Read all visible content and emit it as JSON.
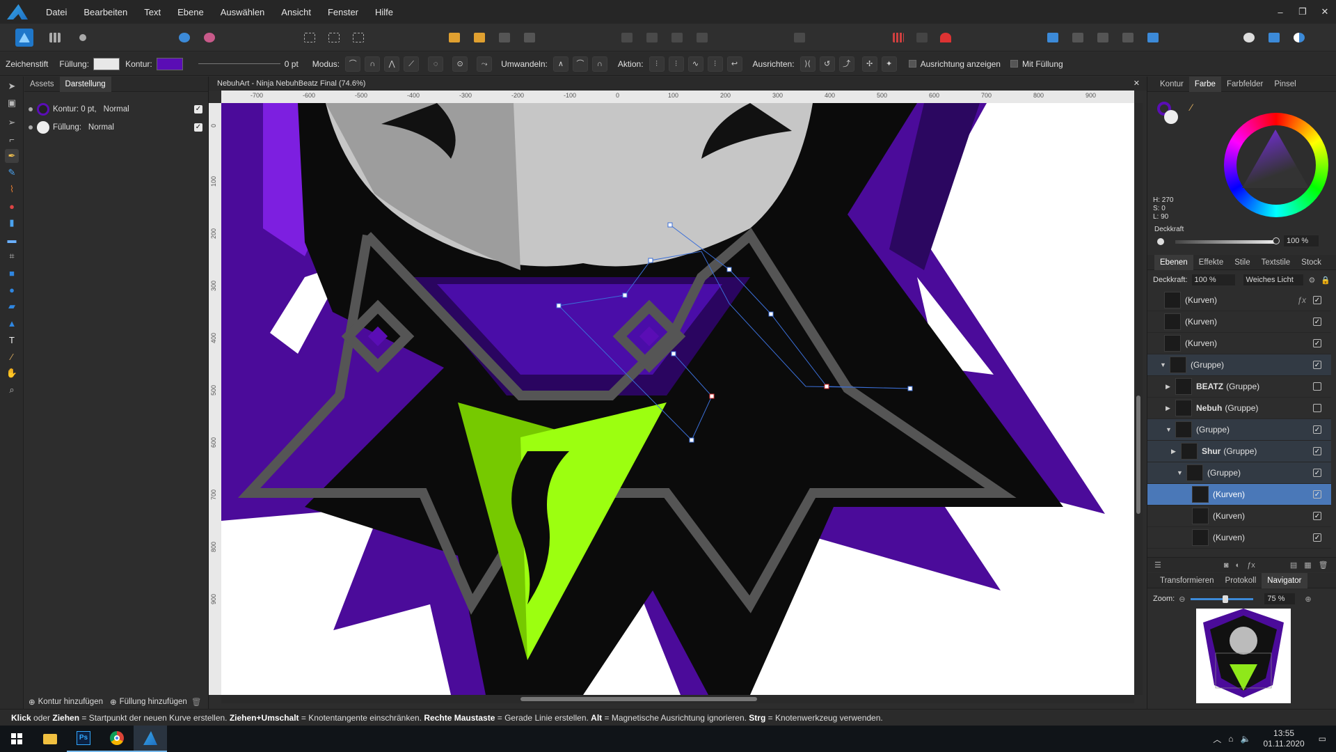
{
  "menubar": {
    "items": [
      "Datei",
      "Bearbeiten",
      "Text",
      "Ebene",
      "Auswählen",
      "Ansicht",
      "Fenster",
      "Hilfe"
    ],
    "window_controls": [
      "–",
      "❐",
      "✕"
    ]
  },
  "context": {
    "tool_name": "Zeichenstift",
    "fill_label": "Füllung:",
    "stroke_label": "Kontur:",
    "stroke_width": "0 pt",
    "mode_label": "Modus:",
    "convert_label": "Umwandeln:",
    "action_label": "Aktion:",
    "align_label": "Ausrichten:",
    "show_alignment": "Ausrichtung anzeigen",
    "with_fill": "Mit Füllung",
    "fill_color": "#e8e8e8",
    "stroke_color": "#5a0db5"
  },
  "leftpanel": {
    "tabs": [
      "Assets",
      "Darstellung"
    ],
    "active_tab": "Darstellung",
    "rows": [
      {
        "label": "Kontur: 0 pt,",
        "blend": "Normal"
      },
      {
        "label": "Füllung:",
        "blend": "Normal"
      }
    ],
    "add_stroke": "Kontur hinzufügen",
    "add_fill": "Füllung hinzufügen"
  },
  "document": {
    "title": "NebuhArt - Ninja NebuhBeatz Final (74.6%)",
    "close": "✕",
    "ruler_h": [
      "-700",
      "-600",
      "-500",
      "-400",
      "-300",
      "-200",
      "-100",
      "0",
      "100",
      "200",
      "300",
      "400",
      "500",
      "600",
      "700",
      "800",
      "900"
    ],
    "ruler_v": [
      "0",
      "100",
      "200",
      "300",
      "400",
      "500",
      "600",
      "700",
      "800",
      "900"
    ]
  },
  "colorpanel": {
    "tabs": [
      "Kontur",
      "Farbe",
      "Farbfelder",
      "Pinsel"
    ],
    "active_tab": "Farbe",
    "h": "H: 270",
    "s": "S: 0",
    "l": "L: 90",
    "opacity_label": "Deckkraft",
    "opacity_value": "100 %"
  },
  "layerspanel": {
    "tabs": [
      "Ebenen",
      "Effekte",
      "Stile",
      "Textstile",
      "Stock"
    ],
    "active_tab": "Ebenen",
    "opacity_label": "Deckkraft:",
    "opacity_value": "100 %",
    "blend_mode": "Weiches Licht",
    "layers": [
      {
        "name": "(Kurven)",
        "bold": "",
        "indent": 0,
        "fx": true,
        "checked": true,
        "state": ""
      },
      {
        "name": "(Kurven)",
        "bold": "",
        "indent": 0,
        "fx": false,
        "checked": true,
        "state": ""
      },
      {
        "name": "(Kurven)",
        "bold": "",
        "indent": 0,
        "fx": false,
        "checked": true,
        "state": ""
      },
      {
        "name": "(Gruppe)",
        "bold": "",
        "indent": 1,
        "fx": false,
        "checked": true,
        "state": "grp"
      },
      {
        "name": "(Gruppe)",
        "bold": "BEATZ",
        "indent": 2,
        "fx": false,
        "checked": false,
        "state": ""
      },
      {
        "name": "(Gruppe)",
        "bold": "Nebuh",
        "indent": 2,
        "fx": false,
        "checked": false,
        "state": ""
      },
      {
        "name": "(Gruppe)",
        "bold": "",
        "indent": 2,
        "fx": false,
        "checked": true,
        "state": "grp"
      },
      {
        "name": "(Gruppe)",
        "bold": "Shur",
        "indent": 3,
        "fx": false,
        "checked": true,
        "state": "grp"
      },
      {
        "name": "(Gruppe)",
        "bold": "",
        "indent": 4,
        "fx": false,
        "checked": true,
        "state": "grp"
      },
      {
        "name": "(Kurven)",
        "bold": "",
        "indent": 5,
        "fx": false,
        "checked": true,
        "state": "sel"
      },
      {
        "name": "(Kurven)",
        "bold": "",
        "indent": 5,
        "fx": false,
        "checked": true,
        "state": ""
      },
      {
        "name": "(Kurven)",
        "bold": "",
        "indent": 5,
        "fx": false,
        "checked": true,
        "state": ""
      }
    ]
  },
  "navpanel": {
    "tabs": [
      "Transformieren",
      "Protokoll",
      "Navigator"
    ],
    "active_tab": "Navigator",
    "zoom_label": "Zoom:",
    "zoom_value": "75 %",
    "zoom_level": 0.55
  },
  "statusbar": {
    "parts": [
      {
        "b": "Klick",
        "t": " oder "
      },
      {
        "b": "Ziehen",
        "t": " = Startpunkt der neuen Kurve erstellen. "
      },
      {
        "b": "Ziehen+Umschalt",
        "t": " = Knotentangente einschränken. "
      },
      {
        "b": "Rechte Maustaste",
        "t": " = Gerade Linie erstellen. "
      },
      {
        "b": "Alt",
        "t": " = Magnetische Ausrichtung ignorieren. "
      },
      {
        "b": "Strg",
        "t": " = Knotenwerkzeug verwenden."
      }
    ]
  },
  "taskbar": {
    "time": "13:55",
    "date": "01.11.2020"
  }
}
